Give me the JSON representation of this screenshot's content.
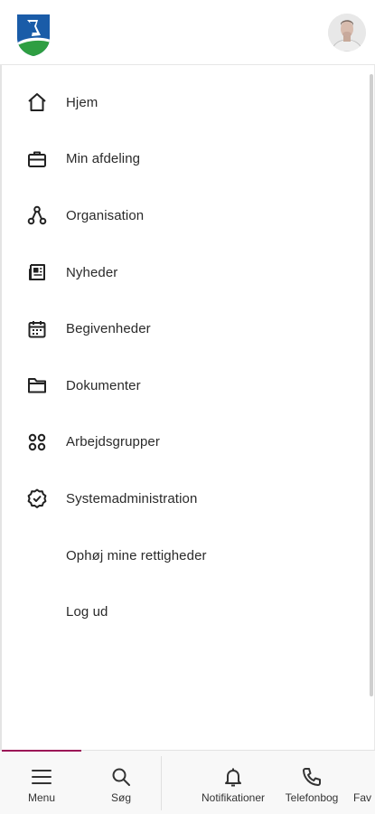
{
  "header": {
    "logo": {
      "icon": "municipality-crest-icon",
      "colors": {
        "blue": "#1a5ca8",
        "green": "#2e9e42"
      }
    },
    "avatar": {
      "icon": "user-avatar"
    }
  },
  "menu": {
    "items": [
      {
        "label": "Hjem",
        "icon": "home-icon"
      },
      {
        "label": "Min afdeling",
        "icon": "briefcase-icon"
      },
      {
        "label": "Organisation",
        "icon": "org-tree-icon"
      },
      {
        "label": "Nyheder",
        "icon": "newspaper-icon"
      },
      {
        "label": "Begivenheder",
        "icon": "calendar-icon"
      },
      {
        "label": "Dokumenter",
        "icon": "folder-icon"
      },
      {
        "label": "Arbejdsgrupper",
        "icon": "groups-icon"
      },
      {
        "label": "Systemadministration",
        "icon": "badge-check-icon"
      },
      {
        "label": "Ophøj mine rettigheder",
        "icon": ""
      },
      {
        "label": "Log ud",
        "icon": ""
      }
    ]
  },
  "bottom_nav": {
    "accent": "#9c1457",
    "items": [
      {
        "label": "Menu",
        "icon": "hamburger-icon",
        "active": true
      },
      {
        "label": "Søg",
        "icon": "search-icon"
      },
      {
        "label": "Notifikationer",
        "icon": "bell-icon"
      },
      {
        "label": "Telefonbog",
        "icon": "phone-icon"
      },
      {
        "label": "Fav",
        "icon": ""
      }
    ]
  }
}
